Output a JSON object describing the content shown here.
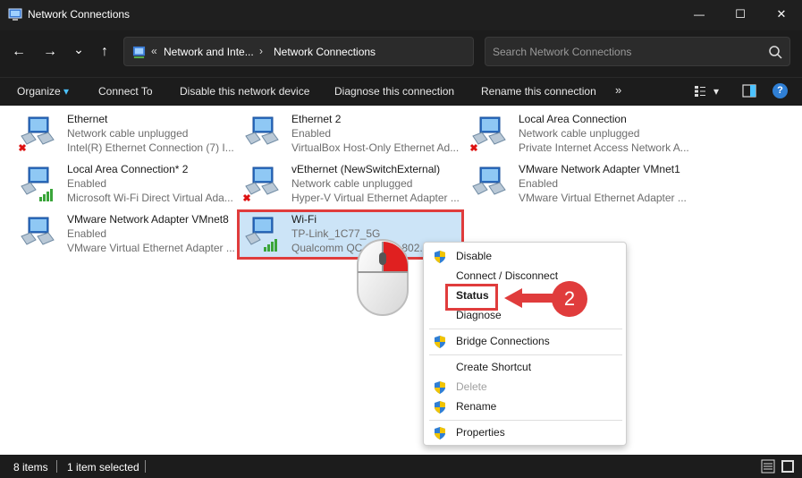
{
  "window": {
    "title": "Network Connections",
    "minimize_glyph": "—",
    "maximize_glyph": "☐",
    "close_glyph": "✕"
  },
  "nav": {
    "back_glyph": "←",
    "forward_glyph": "→",
    "recent_glyph": "⌄",
    "up_glyph": "↑",
    "overflow": "«",
    "crumb1": "Network and Inte...",
    "crumb2": "Network Connections",
    "sep": "›",
    "search_placeholder": "Search Network Connections"
  },
  "commands": {
    "organize": "Organize",
    "organize_caret": "▾",
    "connect_to": "Connect To",
    "disable": "Disable this network device",
    "diagnose": "Diagnose this connection",
    "rename": "Rename this connection",
    "more": "»",
    "view_caret": "▾",
    "help": "?"
  },
  "connections": [
    {
      "name": "Ethernet",
      "status": "Network cable unplugged",
      "device": "Intel(R) Ethernet Connection (7) I...",
      "type": "ethernet",
      "state": "unplugged"
    },
    {
      "name": "Ethernet 2",
      "status": "Enabled",
      "device": "VirtualBox Host-Only Ethernet Ad...",
      "type": "ethernet",
      "state": "enabled"
    },
    {
      "name": "Local Area Connection",
      "status": "Network cable unplugged",
      "device": "Private Internet Access Network A...",
      "type": "ethernet",
      "state": "unplugged"
    },
    {
      "name": "Local Area Connection* 2",
      "status": "Enabled",
      "device": "Microsoft Wi-Fi Direct Virtual Ada...",
      "type": "wifi",
      "state": "enabled"
    },
    {
      "name": "vEthernet (NewSwitchExternal)",
      "status": "Network cable unplugged",
      "device": "Hyper-V Virtual Ethernet Adapter ...",
      "type": "ethernet",
      "state": "unplugged"
    },
    {
      "name": "VMware Network Adapter VMnet1",
      "status": "Enabled",
      "device": "VMware Virtual Ethernet Adapter ...",
      "type": "ethernet",
      "state": "enabled"
    },
    {
      "name": "VMware Network Adapter VMnet8",
      "status": "Enabled",
      "device": "VMware Virtual Ethernet Adapter ...",
      "type": "ethernet",
      "state": "enabled"
    },
    {
      "name": "Wi-Fi",
      "status": "TP-Link_1C77_5G",
      "device": "Qualcomm QC",
      "device_suffix": "802.1",
      "type": "wifi",
      "state": "selected"
    }
  ],
  "context_menu": {
    "items": [
      {
        "label": "Disable",
        "shield": true
      },
      {
        "label": "Connect / Disconnect",
        "shield": false
      },
      {
        "label": "Status",
        "shield": false,
        "bold": true
      },
      {
        "label": "Diagnose",
        "shield": false
      },
      {
        "label": "Bridge Connections",
        "shield": true
      },
      {
        "label": "Create Shortcut",
        "shield": false
      },
      {
        "label": "Delete",
        "shield": true,
        "disabled": true
      },
      {
        "label": "Rename",
        "shield": true
      },
      {
        "label": "Properties",
        "shield": true
      }
    ]
  },
  "annotation": {
    "step_number": "2",
    "color": "#e03c3c"
  },
  "statusbar": {
    "item_count": "8 items",
    "selection": "1 item selected"
  },
  "colors": {
    "dark_bg": "#1c1c1c",
    "selection": "#cce4f7",
    "highlight_red": "#e03c3c",
    "accent_blue": "#4cc2ff"
  }
}
